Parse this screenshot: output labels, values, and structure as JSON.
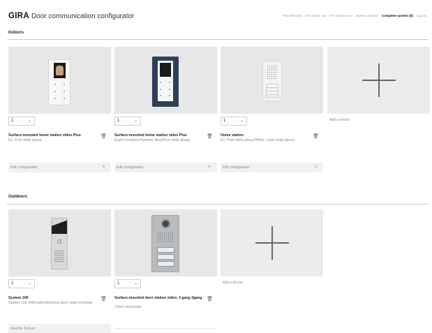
{
  "header": {
    "brand": "GIRA",
    "title": "Door communication configurator",
    "nav": [
      "Pre-selection",
      "For indoor use",
      "For outdoor use",
      "System devices",
      "Complete system (5)",
      "Log on"
    ],
    "active_nav": "Complete system (5)"
  },
  "indoors": {
    "title": "Indoors",
    "cards": [
      {
        "quantity": "1",
        "name": "Surface-mounted home station video Plus",
        "description": "E2, Pure white glossy",
        "edit_label": "Edit configuration",
        "device": "home-station-video-white"
      },
      {
        "quantity": "1",
        "name": "Surface-mounted home station video Plus",
        "description": "Esprit Linoleum-Plywood, Blue/Pure white glossy",
        "edit_label": "Edit configuration",
        "device": "home-station-video-blue"
      },
      {
        "quantity": "1",
        "name": "Home station",
        "description": "E2, Pure white glossy/White + pure white glossy",
        "edit_label": "Edit configuration",
        "device": "home-station"
      }
    ],
    "add_label": "Add a device"
  },
  "outdoors": {
    "title": "Outdoors",
    "cards": [
      {
        "quantity": "1",
        "name": "System 106",
        "description": "System 106, Anthracite/Stainless steel, laser-inscribed",
        "edit_label": "Inscribe Texture",
        "device": "system-106"
      },
      {
        "quantity": "1",
        "name": "Surface-mounted door station video, 3 gang 3gang",
        "description": "Colour aluminium",
        "device": "door-station-video"
      }
    ],
    "add_label": "Add a device"
  },
  "icons": {
    "trash": "trash-icon",
    "pencil": "pencil-icon",
    "chevron": "chevron-down-icon",
    "plus": "plus-icon"
  }
}
